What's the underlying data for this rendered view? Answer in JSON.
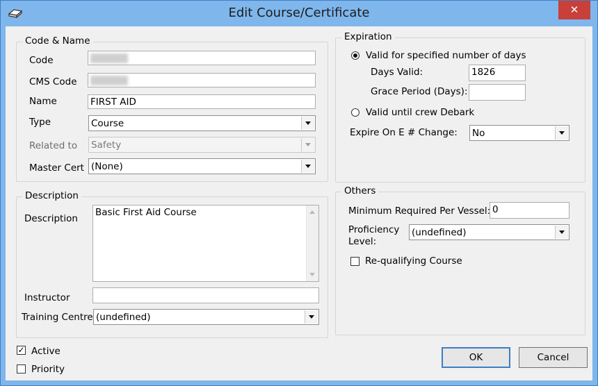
{
  "window": {
    "title": "Edit Course/Certificate",
    "close_glyph": "✕"
  },
  "code_name": {
    "legend": "Code & Name",
    "code_label": "Code",
    "code_value": "",
    "cms_code_label": "CMS Code",
    "cms_code_value": "",
    "name_label": "Name",
    "name_value": "FIRST AID",
    "type_label": "Type",
    "type_value": "Course",
    "related_label": "Related to",
    "related_value": "Safety",
    "master_label": "Master Cert",
    "master_value": "(None)"
  },
  "description": {
    "legend": "Description",
    "desc_label": "Description",
    "desc_value": "Basic First Aid Course",
    "instructor_label": "Instructor",
    "instructor_value": "",
    "training_label": "Training Centre",
    "training_value": "(undefined)"
  },
  "expiration": {
    "legend": "Expiration",
    "opt_days_label": "Valid for specified number of days",
    "opt_days_selected": true,
    "days_valid_label": "Days Valid:",
    "days_valid_value": "1826",
    "grace_label": "Grace Period (Days):",
    "grace_value": "",
    "opt_debark_label": "Valid until crew Debark",
    "opt_debark_selected": false,
    "expire_label": "Expire On E # Change:",
    "expire_value": "No"
  },
  "others": {
    "legend": "Others",
    "min_label": "Minimum Required Per Vessel:",
    "min_value": "0",
    "prof_label_1": "Proficiency",
    "prof_label_2": "Level:",
    "prof_value": "(undefined)",
    "requal_label": "Re-qualifying Course",
    "requal_checked": false
  },
  "footer": {
    "active_label": "Active",
    "active_checked": true,
    "priority_label": "Priority",
    "priority_checked": false,
    "ok_label": "OK",
    "cancel_label": "Cancel"
  }
}
